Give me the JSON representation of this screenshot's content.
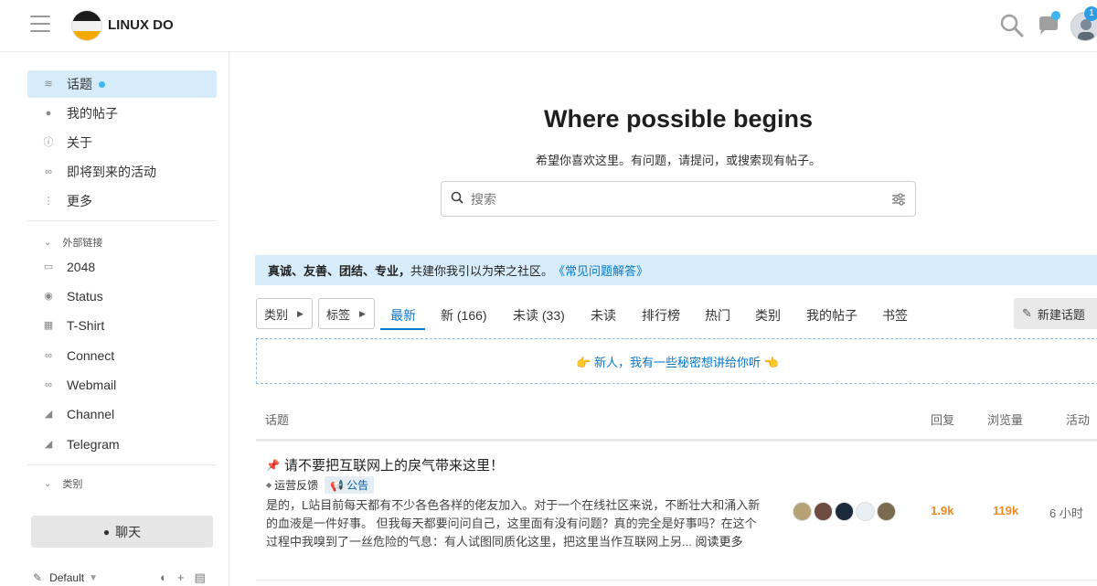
{
  "header": {
    "site_title": "LINUX DO",
    "notification_count": "1",
    "icons": [
      "hamburger-icon",
      "search-icon",
      "chat-icon",
      "avatar"
    ]
  },
  "sidebar": {
    "items": [
      {
        "label": "话题",
        "icon": "layers-icon",
        "active": true
      },
      {
        "label": "我的帖子",
        "icon": "user-icon"
      },
      {
        "label": "关于",
        "icon": "info-icon"
      },
      {
        "label": "即将到来的活动",
        "icon": "link-icon"
      },
      {
        "label": "更多",
        "icon": "more-icon"
      }
    ],
    "external_section": "外部链接",
    "external_links": [
      {
        "label": "2048",
        "icon": "gamepad-icon"
      },
      {
        "label": "Status",
        "icon": "eye-icon"
      },
      {
        "label": "T-Shirt",
        "icon": "gift-icon"
      },
      {
        "label": "Connect",
        "icon": "link-icon"
      },
      {
        "label": "Webmail",
        "icon": "link-icon"
      },
      {
        "label": "Channel",
        "icon": "telegram-icon"
      },
      {
        "label": "Telegram",
        "icon": "telegram-icon"
      }
    ],
    "categories_section": "类别",
    "chat_button": "聊天",
    "theme_label": "Default"
  },
  "hero": {
    "title": "Where possible begins",
    "subtitle": "希望你喜欢这里。有问题，请提问，或搜索现有帖子。",
    "search_placeholder": "搜索"
  },
  "banner": {
    "bold_text": "真诚、友善、团结、专业，",
    "text": "共建你我引以为荣之社区。",
    "link": "《常见问题解答》"
  },
  "nav": {
    "category_dropdown": "类别",
    "tag_dropdown": "标签",
    "tabs": [
      "最新",
      "新 (166)",
      "未读 (33)",
      "未读",
      "排行榜",
      "热门",
      "类别",
      "我的帖子",
      "书签"
    ],
    "active_tab": "最新",
    "new_topic_button": "新建话题"
  },
  "notice": "👉 新人，我有一些秘密想讲给你听 👈",
  "table": {
    "headers": {
      "topic": "话题",
      "replies": "回复",
      "views": "浏览量",
      "activity": "活动"
    }
  },
  "topics": [
    {
      "title": "请不要把互联网上的戾气带来这里！",
      "pinned": true,
      "category": "运营反馈",
      "tag": "公告",
      "excerpt": "是的，L站目前每天都有不少各色各样的佬友加入。对于一个在线社区来说，不断壮大和涌入新的血液是一件好事。 但我每天都要问问自己，这里面有没有问题？真的完全是好事吗？在这个过程中我嗅到了一丝危险的气息：有人试图同质化这里，把这里当作互联网上另...",
      "read_more": "阅读更多",
      "replies": "1.9k",
      "views": "119k",
      "activity": "6 小时",
      "poster_colors": [
        "#b7a275",
        "#6d4b3e",
        "#1a2a3a",
        "#e8eef3",
        "#7a6a4f"
      ]
    }
  ],
  "colors": {
    "accent": "#0a77c7",
    "active_bg": "#d6ecfa",
    "stat_orange": "#f08a24",
    "unread_dot": "#3fb6f0"
  }
}
